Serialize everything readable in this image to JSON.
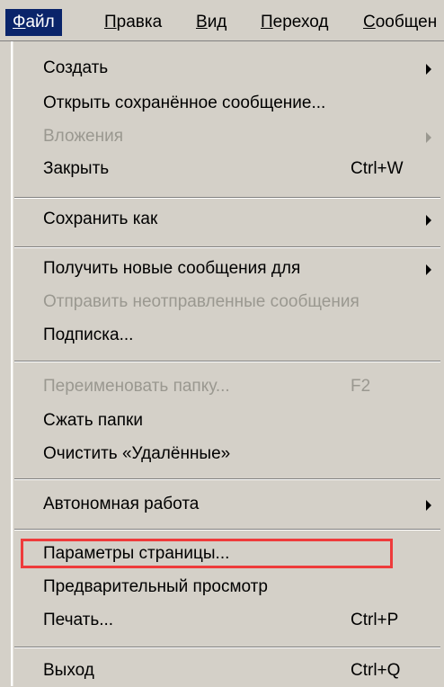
{
  "menubar": {
    "items": [
      {
        "label": "Файл",
        "active": true
      },
      {
        "label": "Правка"
      },
      {
        "label": "Вид"
      },
      {
        "label": "Переход"
      },
      {
        "label": "Сообщен"
      }
    ]
  },
  "menu": {
    "items": [
      {
        "label": "Создать",
        "submenu": true
      },
      {
        "label": "Открыть сохранённое сообщение..."
      },
      {
        "label": "Вложения",
        "disabled": true,
        "submenu": true
      },
      {
        "label": "Закрыть",
        "shortcut": "Ctrl+W"
      },
      {
        "label": "Сохранить как",
        "submenu": true
      },
      {
        "label": "Получить новые сообщения для",
        "submenu": true
      },
      {
        "label": "Отправить неотправленные сообщения",
        "disabled": true
      },
      {
        "label": "Подписка..."
      },
      {
        "label": "Переименовать папку...",
        "shortcut": "F2",
        "disabled": true
      },
      {
        "label": "Сжать папки"
      },
      {
        "label": "Очистить «Удалённые»"
      },
      {
        "label": "Автономная работа",
        "submenu": true
      },
      {
        "label": "Параметры страницы...",
        "highlighted": true
      },
      {
        "label": "Предварительный просмотр"
      },
      {
        "label": "Печать...",
        "shortcut": "Ctrl+P"
      },
      {
        "label": "Выход",
        "shortcut": "Ctrl+Q"
      }
    ]
  },
  "colors": {
    "menu_bg": "#d4d0c8",
    "active_menu_bg": "#0a246a",
    "disabled_text": "#9a9890",
    "highlight_box": "#ee3b3b"
  }
}
